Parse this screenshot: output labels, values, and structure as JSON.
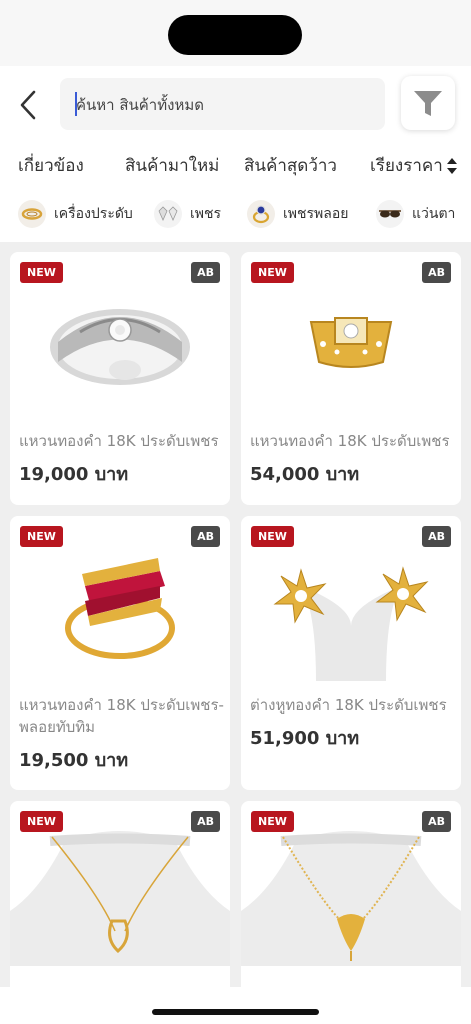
{
  "search": {
    "placeholder_text": "ค้นหา สินค้าทั้งหมด"
  },
  "sort_tabs": [
    {
      "label": "เกี่ยวข้อง"
    },
    {
      "label": "สินค้ามาใหม่"
    },
    {
      "label": "สินค้าสุดว้าว"
    },
    {
      "label": "เรียงราคา"
    }
  ],
  "categories": [
    {
      "label": "เครื่องประดับ",
      "icon": "ring-icon"
    },
    {
      "label": "เพชร",
      "icon": "diamond-icon"
    },
    {
      "label": "เพชรพลอย",
      "icon": "gem-ring-icon"
    },
    {
      "label": "แว่นตา",
      "icon": "sunglasses-icon"
    }
  ],
  "products": [
    {
      "badge_new": "NEW",
      "badge_grade": "AB",
      "name": "แหวนทองคำ 18K ประดับเพชร",
      "price": "19,000 บาท",
      "image": "white-gold-diamond-ring"
    },
    {
      "badge_new": "NEW",
      "badge_grade": "AB",
      "name": "แหวนทองคำ 18K ประดับเพชร",
      "price": "54,000 บาท",
      "image": "gold-diamond-signet-ring"
    },
    {
      "badge_new": "NEW",
      "badge_grade": "AB",
      "name": "แหวนทองคำ 18K ประดับเพชร-พลอยทับทิม",
      "price": "19,500 บาท",
      "image": "gold-ruby-ring"
    },
    {
      "badge_new": "NEW",
      "badge_grade": "AB",
      "name": "ต่างหูทองคำ 18K ประดับเพชร",
      "price": "51,900 บาท",
      "image": "gold-star-earrings"
    },
    {
      "badge_new": "NEW",
      "badge_grade": "AB",
      "name": "",
      "price": "",
      "image": "gold-necklace-heart"
    },
    {
      "badge_new": "NEW",
      "badge_grade": "AB",
      "name": "",
      "price": "",
      "image": "gold-necklace-pendant"
    }
  ],
  "colors": {
    "new_badge": "#b8161f",
    "grade_badge": "#4a4a4a",
    "caret": "#3a5bd6"
  }
}
